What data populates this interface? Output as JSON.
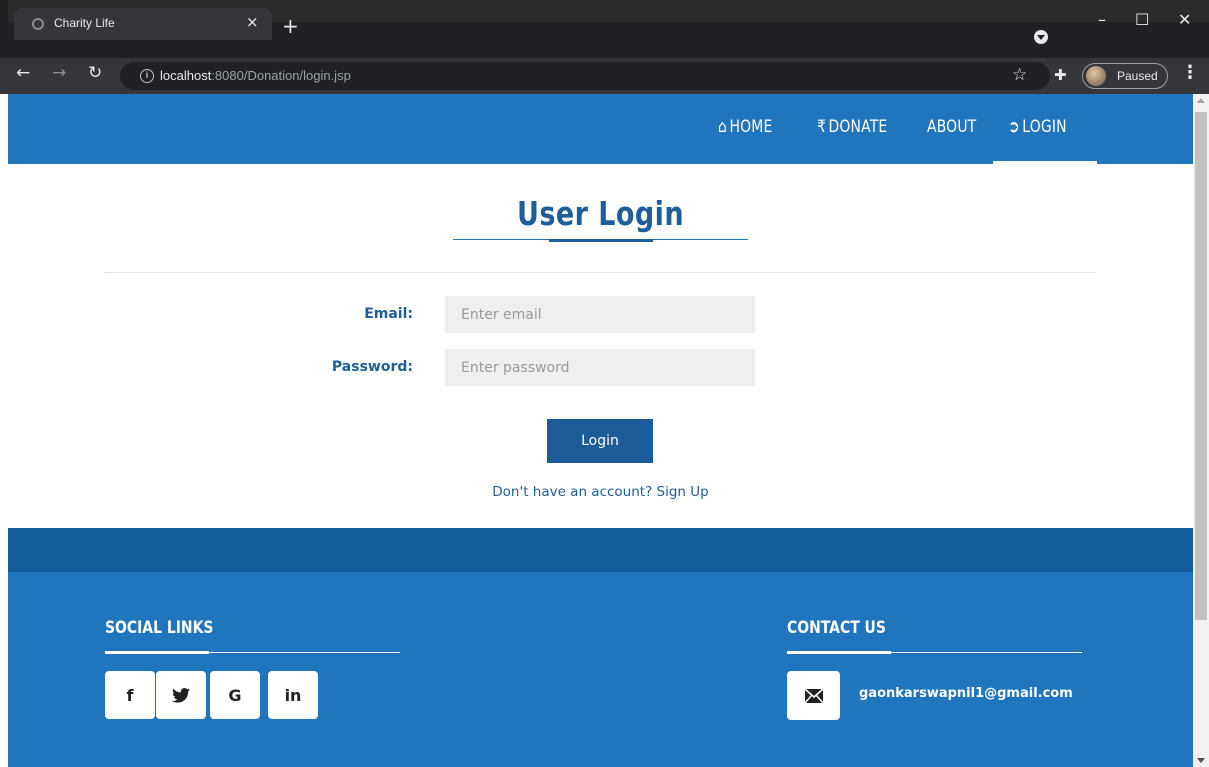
{
  "browser": {
    "tab_title": "Charity Life",
    "tab_close": "×",
    "new_tab": "+",
    "url_host": "localhost",
    "url_rest": ":8080/Donation/login.jsp",
    "profile_status": "Paused",
    "window_controls": {
      "minimize": "–",
      "maximize": "☐",
      "close": "✕"
    },
    "icons": [
      "globe-icon",
      "close-icon",
      "plus-icon",
      "back-icon",
      "forward-icon",
      "reload-icon",
      "info-icon",
      "star-icon",
      "puzzle-icon",
      "avatar",
      "more-vertical-icon"
    ]
  },
  "nav": {
    "items": [
      {
        "label": "HOME",
        "icon": "⌂"
      },
      {
        "label": "DONATE",
        "icon": "₹"
      },
      {
        "label": "ABOUT",
        "icon": ""
      },
      {
        "label": "LOGIN",
        "icon": "➲"
      }
    ],
    "active": "LOGIN"
  },
  "login": {
    "title": "User Login",
    "email_label": "Email:",
    "email_placeholder": "Enter email",
    "password_label": "Password:",
    "password_placeholder": "Enter password",
    "button": "Login",
    "signup_text": "Don't have an account? Sign Up"
  },
  "footer": {
    "social_heading": "SOCIAL LINKS",
    "social": [
      {
        "label": "f",
        "icon": "facebook-icon"
      },
      {
        "label": "🐦",
        "icon": "twitter-icon"
      },
      {
        "label": "G",
        "icon": "google-icon"
      },
      {
        "label": "in",
        "icon": "linkedin-icon"
      }
    ],
    "contact_heading": "CONTACT US",
    "contact_email": "gaonkarswapnil1@gmail.com"
  },
  "colors": {
    "brand_blue": "#2075bd",
    "dark_blue": "#145d9b",
    "text_blue": "#1f5e99",
    "button_blue": "#1c5d99"
  }
}
